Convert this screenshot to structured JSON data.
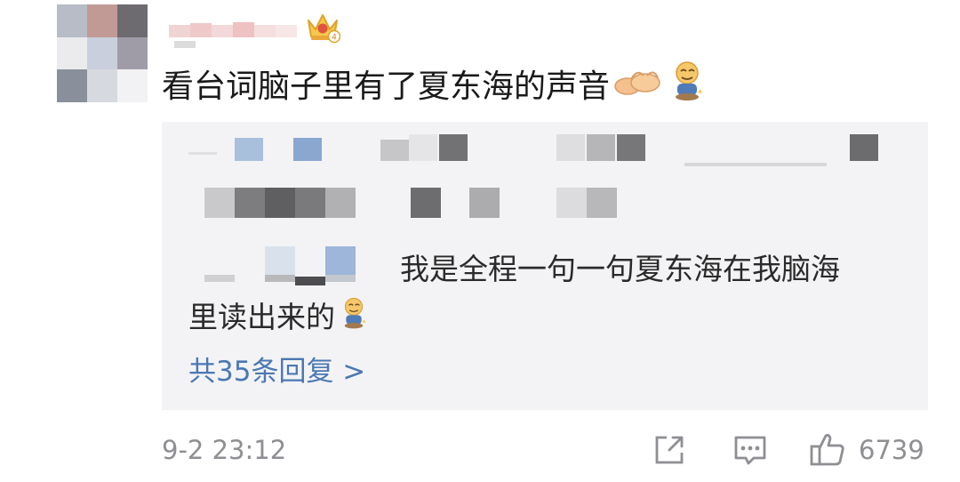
{
  "comment": {
    "text": "看台词脑子里有了夏东海的声音",
    "emojis": [
      "ok-hand-emoji",
      "doge-emoji"
    ],
    "username_redacted": true,
    "badge_icon": "crown-badge-icon"
  },
  "reply_preview": {
    "redacted_lines": 3,
    "reply_line1": "我是全程一句一句夏东海在我脑海",
    "reply_line2": "里读出来的",
    "reply_emoji": "doge-emoji",
    "more_replies_label": "共35条回复 >"
  },
  "footer": {
    "date": "9-2 23:12",
    "share_icon": "share-icon",
    "comment_icon": "comment-icon",
    "like_icon": "thumbs-up-icon",
    "like_count": "6739"
  },
  "colors": {
    "link": "#4a78b4",
    "meta": "#8e8e93",
    "reply_bg": "#f3f3f5",
    "text": "#1a1a1a"
  }
}
